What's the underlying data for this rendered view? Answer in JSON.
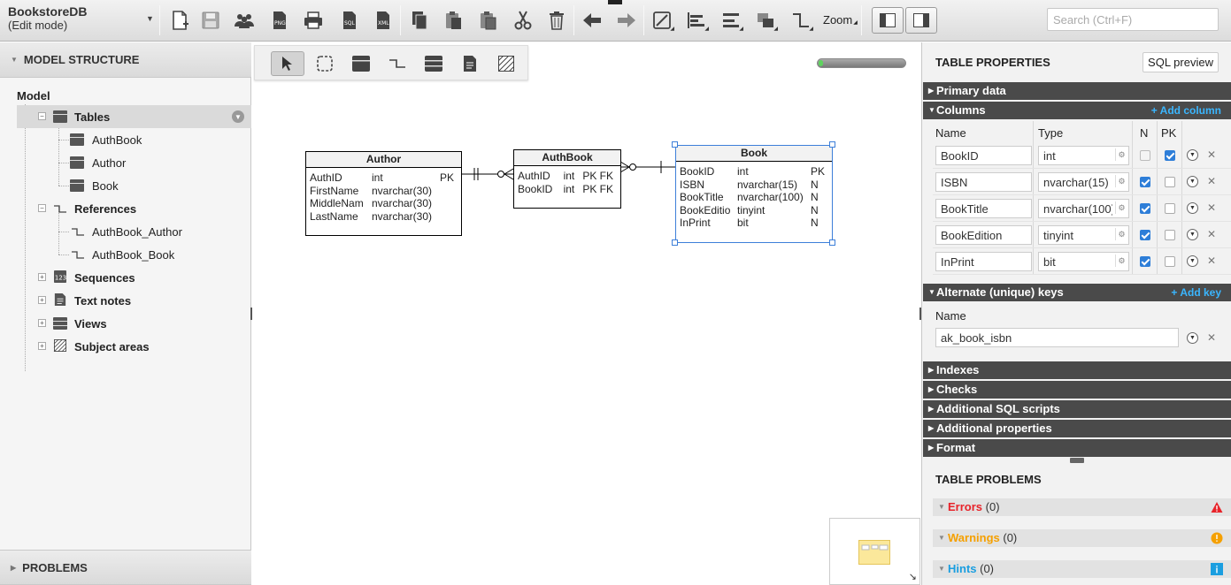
{
  "app": {
    "title": "BookstoreDB",
    "mode": "(Edit mode)"
  },
  "toolbar": {
    "zoom_label": "Zoom",
    "search_placeholder": "Search (Ctrl+F)",
    "icons": [
      "new-document-icon",
      "save-icon",
      "users-icon",
      "png-export-icon",
      "print-icon",
      "sql-export-icon",
      "xml-export-icon",
      "copy-icon",
      "paste-icon",
      "paste-special-icon",
      "cut-icon",
      "delete-icon",
      "undo-arrow-icon",
      "redo-arrow-icon",
      "edit-line-icon",
      "align-icon",
      "distribute-icon",
      "arrange-icon",
      "connector-icon",
      "layout-left-icon",
      "layout-right-icon"
    ]
  },
  "left_panel": {
    "header": "MODEL STRUCTURE",
    "footer": "PROBLEMS",
    "tree": {
      "root": "Model",
      "tables_label": "Tables",
      "tables": [
        "AuthBook",
        "Author",
        "Book"
      ],
      "references_label": "References",
      "references": [
        "AuthBook_Author",
        "AuthBook_Book"
      ],
      "sequences_label": "Sequences",
      "text_notes_label": "Text notes",
      "views_label": "Views",
      "subject_areas_label": "Subject areas"
    }
  },
  "canvas": {
    "progress_fraction": 0.05,
    "entities": [
      {
        "name": "Author",
        "columns": [
          [
            "AuthID",
            "int",
            "PK"
          ],
          [
            "FirstName",
            "nvarchar(30)",
            ""
          ],
          [
            "MiddleNam",
            "nvarchar(30)",
            ""
          ],
          [
            "LastName",
            "nvarchar(30)",
            ""
          ]
        ]
      },
      {
        "name": "AuthBook",
        "columns": [
          [
            "AuthID",
            "int",
            "PK FK"
          ],
          [
            "BookID",
            "int",
            "PK FK"
          ]
        ]
      },
      {
        "name": "Book",
        "columns": [
          [
            "BookID",
            "int",
            "PK"
          ],
          [
            "ISBN",
            "nvarchar(15)",
            "N"
          ],
          [
            "BookTitle",
            "nvarchar(100)",
            "N"
          ],
          [
            "BookEditio",
            "tinyint",
            "N"
          ],
          [
            "InPrint",
            "bit",
            "N"
          ]
        ]
      }
    ]
  },
  "right_panel": {
    "title": "TABLE PROPERTIES",
    "sql_preview": "SQL preview",
    "sections": {
      "primary_data": "Primary data",
      "columns": "Columns",
      "add_column": "+ Add column",
      "alternate_keys": "Alternate (unique) keys",
      "add_key": "+ Add key",
      "indexes": "Indexes",
      "checks": "Checks",
      "additional_sql": "Additional SQL scripts",
      "additional_props": "Additional properties",
      "format": "Format"
    },
    "column_headers": {
      "name": "Name",
      "type": "Type",
      "n": "N",
      "pk": "PK"
    },
    "columns": [
      {
        "name": "BookID",
        "type": "int",
        "n": false,
        "pk": true
      },
      {
        "name": "ISBN",
        "type": "nvarchar(15)",
        "n": true,
        "pk": false
      },
      {
        "name": "BookTitle",
        "type": "nvarchar(100)",
        "n": true,
        "pk": false
      },
      {
        "name": "BookEdition",
        "type": "tinyint",
        "n": true,
        "pk": false
      },
      {
        "name": "InPrint",
        "type": "bit",
        "n": true,
        "pk": false
      }
    ],
    "alt_key_header": "Name",
    "alt_keys": [
      "ak_book_isbn"
    ],
    "problems": {
      "title": "TABLE PROBLEMS",
      "errors_label": "Errors",
      "errors_count": "(0)",
      "warnings_label": "Warnings",
      "warnings_count": "(0)",
      "hints_label": "Hints",
      "hints_count": "(0)",
      "colors": {
        "errors": "#e8232a",
        "warnings": "#f5a000",
        "hints": "#1a9ee0"
      }
    }
  }
}
